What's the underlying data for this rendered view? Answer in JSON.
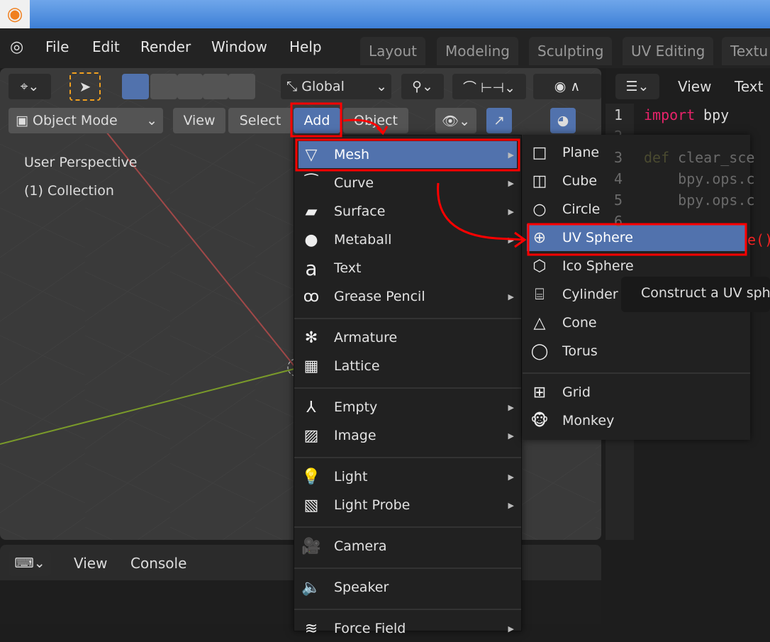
{
  "title_bar": {
    "app_icon": "blender-logo-icon"
  },
  "top_menu": {
    "items": [
      "File",
      "Edit",
      "Render",
      "Window",
      "Help"
    ]
  },
  "workspace_tabs": [
    "Layout",
    "Modeling",
    "Sculpting",
    "UV Editing",
    "Textu"
  ],
  "viewport": {
    "transform_orientation": "Global",
    "mode": "Object Mode",
    "header_menus": {
      "view": "View",
      "select": "Select",
      "add": "Add",
      "object": "Object"
    },
    "perspective_label": "User Perspective",
    "collection_label": "(1) Collection"
  },
  "text_editor": {
    "menus": {
      "view": "View",
      "text": "Text"
    },
    "lines": [
      {
        "n": "1",
        "keyword": "import",
        "rest": " bpy"
      },
      {
        "n": "2"
      },
      {
        "n": "3",
        "keyword": "def",
        "rest": " clear_sce"
      },
      {
        "n": "4",
        "rest": "    bpy.ops.c"
      },
      {
        "n": "5",
        "rest": "    bpy.ops.c"
      },
      {
        "n": "6"
      }
    ],
    "line_extra": "e()"
  },
  "console": {
    "menus": {
      "view": "View",
      "console": "Console"
    }
  },
  "add_menu": {
    "items": [
      {
        "label": "Mesh",
        "icon": "mesh-icon",
        "submenu": true,
        "highlighted": true
      },
      {
        "label": "Curve",
        "icon": "curve-icon",
        "submenu": true
      },
      {
        "label": "Surface",
        "icon": "surface-icon",
        "submenu": true
      },
      {
        "label": "Metaball",
        "icon": "metaball-icon",
        "submenu": true
      },
      {
        "label": "Text",
        "icon": "text-icon",
        "submenu": false
      },
      {
        "label": "Grease Pencil",
        "icon": "grease-pencil-icon",
        "submenu": true
      },
      {
        "label": "Armature",
        "icon": "armature-icon",
        "submenu": false
      },
      {
        "label": "Lattice",
        "icon": "lattice-icon",
        "submenu": false
      },
      {
        "label": "Empty",
        "icon": "empty-icon",
        "submenu": true
      },
      {
        "label": "Image",
        "icon": "image-icon",
        "submenu": true
      },
      {
        "label": "Light",
        "icon": "light-icon",
        "submenu": true
      },
      {
        "label": "Light Probe",
        "icon": "light-probe-icon",
        "submenu": true
      },
      {
        "label": "Camera",
        "icon": "camera-icon",
        "submenu": false
      },
      {
        "label": "Speaker",
        "icon": "speaker-icon",
        "submenu": false
      },
      {
        "label": "Force Field",
        "icon": "force-field-icon",
        "submenu": true
      }
    ]
  },
  "mesh_submenu": {
    "items": [
      {
        "label": "Plane",
        "icon": "plane-icon"
      },
      {
        "label": "Cube",
        "icon": "cube-icon"
      },
      {
        "label": "Circle",
        "icon": "circle-icon"
      },
      {
        "label": "UV Sphere",
        "icon": "uv-sphere-icon",
        "highlighted": true
      },
      {
        "label": "Ico Sphere",
        "icon": "ico-sphere-icon"
      },
      {
        "label": "Cylinder",
        "icon": "cylinder-icon"
      },
      {
        "label": "Cone",
        "icon": "cone-icon"
      },
      {
        "label": "Torus",
        "icon": "torus-icon"
      },
      {
        "label": "Grid",
        "icon": "grid-icon"
      },
      {
        "label": "Monkey",
        "icon": "monkey-icon"
      }
    ]
  },
  "tooltip": {
    "text": "Construct a UV sphere mesh"
  },
  "colors": {
    "highlight": "#5172ad",
    "annotation": "#ff0000",
    "keyword": "#e8236a"
  }
}
